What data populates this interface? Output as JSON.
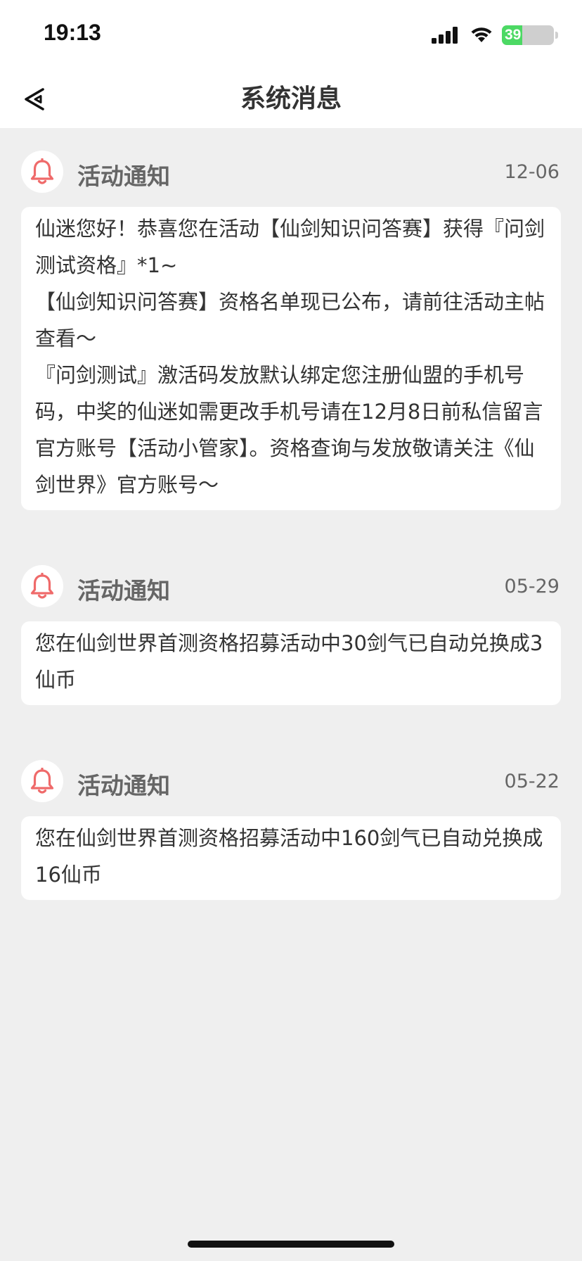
{
  "status_bar": {
    "time": "19:13",
    "battery_level": "39",
    "battery_fill_fraction": 0.39,
    "battery_color": "#4cd964"
  },
  "nav": {
    "title": "系统消息",
    "back_icon": "back-arrow-icon"
  },
  "messages": [
    {
      "icon": "bell-icon",
      "category": "活动通知",
      "date": "12-06",
      "body": "仙迷您好！恭喜您在活动【仙剑知识问答赛】获得『问剑测试资格』*1~\n【仙剑知识问答赛】资格名单现已公布，请前往活动主帖查看～\n『问剑测试』激活码发放默认绑定您注册仙盟的手机号码，中奖的仙迷如需更改手机号请在12月8日前私信留言官方账号【活动小管家】。资格查询与发放敬请关注《仙剑世界》官方账号～"
    },
    {
      "icon": "bell-icon",
      "category": "活动通知",
      "date": "05-29",
      "body": "您在仙剑世界首测资格招募活动中30剑气已自动兑换成3仙币"
    },
    {
      "icon": "bell-icon",
      "category": "活动通知",
      "date": "05-22",
      "body": "您在仙剑世界首测资格招募活动中160剑气已自动兑换成16仙币"
    }
  ],
  "colors": {
    "bell": "#ef6a6a",
    "background": "#efefef",
    "card": "#ffffff"
  }
}
